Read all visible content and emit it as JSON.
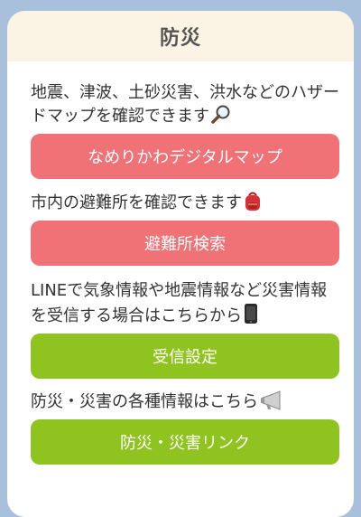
{
  "header": {
    "title": "防災"
  },
  "sections": [
    {
      "description": "地震、津波、土砂災害、洪水などのハザードマップを確認できます",
      "icon": "magnifier-icon",
      "button_label": "なめりかわデジタルマップ",
      "button_color": "#f07276"
    },
    {
      "description": "市内の避難所を確認できます",
      "icon": "backpack-icon",
      "button_label": "避難所検索",
      "button_color": "#f07276"
    },
    {
      "description": "LINEで気象情報や地震情報など災害情報を受信する場合はこちらから",
      "icon": "mobile-phone-icon",
      "button_label": "受信設定",
      "button_color": "#8fc31f"
    },
    {
      "description": "防災・災害の各種情報はこちら",
      "icon": "megaphone-icon",
      "button_label": "防災・災害リンク",
      "button_color": "#8fc31f"
    }
  ],
  "colors": {
    "background": "#a9c0dc",
    "header_bg": "#fbf3e4",
    "red": "#f07276",
    "green": "#8fc31f"
  }
}
